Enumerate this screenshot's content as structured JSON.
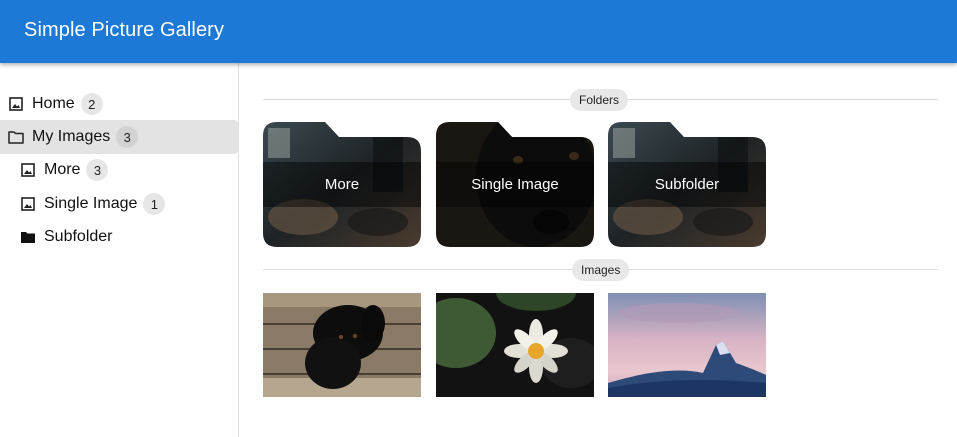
{
  "app": {
    "title": "Simple Picture Gallery"
  },
  "sidebar": {
    "items": [
      {
        "label": "Home",
        "count": "2",
        "icon": "image-icon"
      },
      {
        "label": "My Images",
        "count": "3",
        "icon": "folder-outline-icon",
        "selected": true
      },
      {
        "label": "More",
        "count": "3",
        "icon": "image-icon"
      },
      {
        "label": "Single Image",
        "count": "1",
        "icon": "image-icon"
      },
      {
        "label": "Subfolder",
        "icon": "folder-filled-icon"
      }
    ]
  },
  "main": {
    "folders_heading": "Folders",
    "images_heading": "Images",
    "folders": [
      {
        "label": "More"
      },
      {
        "label": "Single Image"
      },
      {
        "label": "Subfolder"
      }
    ],
    "images": [
      {
        "name": "black-dog-on-wood"
      },
      {
        "name": "water-lily"
      },
      {
        "name": "snowy-mountain-peak"
      }
    ]
  },
  "colors": {
    "appbar": "#1e78d6",
    "selected_bg": "#e3e3e3",
    "badge_bg": "#e6e6e6"
  }
}
